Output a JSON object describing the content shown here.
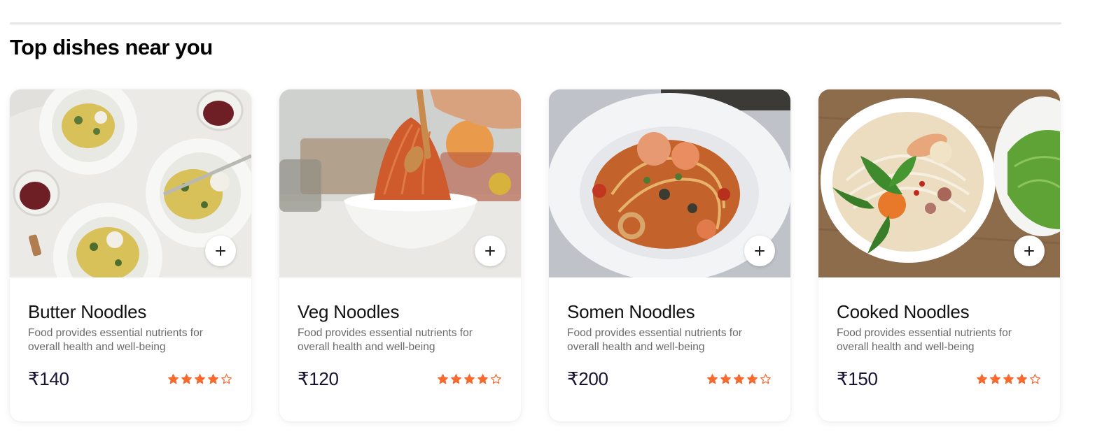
{
  "section": {
    "title": "Top dishes near you"
  },
  "accent_color": "#f56a2e",
  "add_icon": "plus-icon",
  "dishes": [
    {
      "name": "Butter Noodles",
      "description": "Food provides essential nutrients for overall health and well-being",
      "price": "₹140",
      "rating": 4,
      "rating_max": 5
    },
    {
      "name": "Veg Noodles",
      "description": "Food provides essential nutrients for overall health and well-being",
      "price": "₹120",
      "rating": 4,
      "rating_max": 5
    },
    {
      "name": "Somen Noodles",
      "description": "Food provides essential nutrients for overall health and well-being",
      "price": "₹200",
      "rating": 4,
      "rating_max": 5
    },
    {
      "name": "Cooked Noodles",
      "description": "Food provides essential nutrients for overall health and well-being",
      "price": "₹150",
      "rating": 4,
      "rating_max": 5
    }
  ]
}
